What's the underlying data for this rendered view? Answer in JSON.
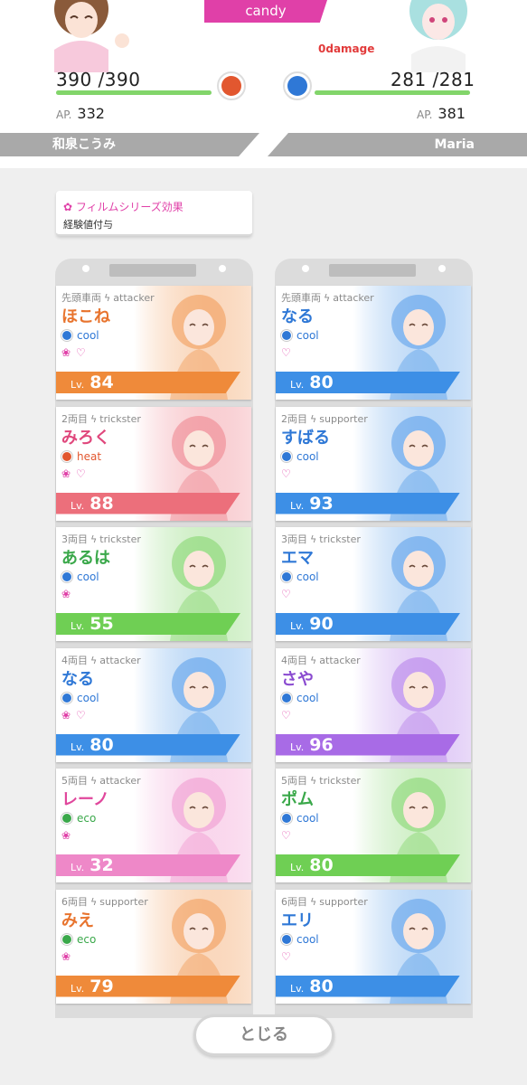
{
  "header": {
    "mode_label": "candy",
    "damage_text": "0damage",
    "player": {
      "name": "和泉こうみ",
      "hp": "390 /390",
      "hp_fraction": 1.0,
      "ap_label": "AP.",
      "ap": "332",
      "type_color": "#e2572f"
    },
    "opponent": {
      "name": "Maria",
      "hp": "281 /281",
      "hp_fraction": 1.0,
      "ap_label": "AP.",
      "ap": "381",
      "type_color": "#2f78d6"
    }
  },
  "effect": {
    "title": "フィルムシリーズ効果",
    "body": "経験値付与"
  },
  "level_label": "Lv.",
  "colors": {
    "accent": "#e040a8",
    "cool": "#2f78d6",
    "heat": "#e2572f",
    "eco": "#3aa84a"
  },
  "left_cars": [
    {
      "pos": "先頭車両",
      "role": "attacker",
      "name": "ほこね",
      "attr": "cool",
      "marks": "❀ ♡",
      "level": "84",
      "bar": "#ef8a3a",
      "name_color": "#e8742e"
    },
    {
      "pos": "2両目",
      "role": "trickster",
      "name": "みろく",
      "attr": "heat",
      "marks": "❀ ♡",
      "level": "88",
      "bar": "#ec6f7b",
      "name_color": "#e0477c"
    },
    {
      "pos": "3両目",
      "role": "trickster",
      "name": "あるは",
      "attr": "cool",
      "marks": "❀",
      "level": "55",
      "bar": "#6fcf54",
      "name_color": "#3aa84a"
    },
    {
      "pos": "4両目",
      "role": "attacker",
      "name": "なる",
      "attr": "cool",
      "marks": "❀ ♡",
      "level": "80",
      "bar": "#3d8fe6",
      "name_color": "#2f78d6"
    },
    {
      "pos": "5両目",
      "role": "attacker",
      "name": "レーノ",
      "attr": "eco",
      "marks": "❀",
      "level": "32",
      "bar": "#ee88c8",
      "name_color": "#e0479c"
    },
    {
      "pos": "6両目",
      "role": "supporter",
      "name": "みえ",
      "attr": "eco",
      "marks": "❀",
      "level": "79",
      "bar": "#ef8a3a",
      "name_color": "#e8742e"
    }
  ],
  "right_cars": [
    {
      "pos": "先頭車両",
      "role": "attacker",
      "name": "なる",
      "attr": "cool",
      "marks": "♡",
      "level": "80",
      "bar": "#3d8fe6",
      "name_color": "#2f78d6"
    },
    {
      "pos": "2両目",
      "role": "supporter",
      "name": "すばる",
      "attr": "cool",
      "marks": "♡",
      "level": "93",
      "bar": "#3d8fe6",
      "name_color": "#2f78d6"
    },
    {
      "pos": "3両目",
      "role": "trickster",
      "name": "エマ",
      "attr": "cool",
      "marks": "♡",
      "level": "90",
      "bar": "#3d8fe6",
      "name_color": "#2f78d6"
    },
    {
      "pos": "4両目",
      "role": "attacker",
      "name": "さや",
      "attr": "cool",
      "marks": "♡",
      "level": "96",
      "bar": "#a86be6",
      "name_color": "#8a4bd0"
    },
    {
      "pos": "5両目",
      "role": "trickster",
      "name": "ポム",
      "attr": "cool",
      "marks": "♡",
      "level": "80",
      "bar": "#6fcf54",
      "name_color": "#3aa84a"
    },
    {
      "pos": "6両目",
      "role": "supporter",
      "name": "エリ",
      "attr": "cool",
      "marks": "♡",
      "level": "80",
      "bar": "#3d8fe6",
      "name_color": "#2f78d6"
    }
  ],
  "close_label": "とじる"
}
